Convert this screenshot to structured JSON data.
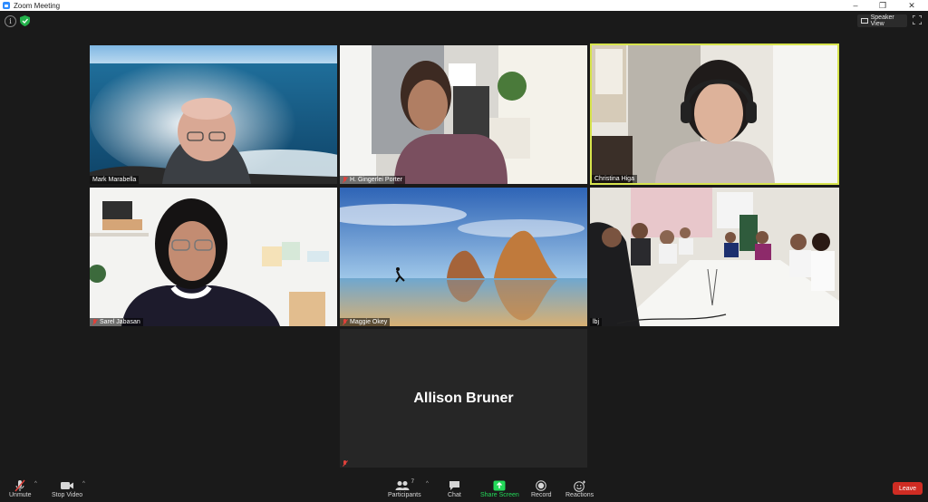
{
  "window": {
    "title": "Zoom Meeting"
  },
  "header": {
    "speaker_view_label": "Speaker View"
  },
  "tiles": [
    {
      "name": "Mark Marabella",
      "muted": false
    },
    {
      "name": "H. Gingerlei Porter",
      "muted": true
    },
    {
      "name": "Christina Higa",
      "muted": false,
      "active_speaker": true
    },
    {
      "name": "Sarel Jabasan",
      "muted": true
    },
    {
      "name": "Maggie Okey",
      "muted": true
    },
    {
      "name": "lbj",
      "muted": false
    },
    {
      "name": "Allison Bruner",
      "muted": true
    }
  ],
  "toolbar": {
    "unmute": "Unmute",
    "stop_video": "Stop Video",
    "participants": "Participants",
    "participants_count": "7",
    "chat": "Chat",
    "share_screen": "Share Screen",
    "record": "Record",
    "reactions": "Reactions",
    "leave": "Leave"
  },
  "colors": {
    "active_speaker_border": "#d7e44d",
    "share_green": "#23d959",
    "leave_red": "#cf2c23",
    "muted_red": "#e0413b"
  }
}
